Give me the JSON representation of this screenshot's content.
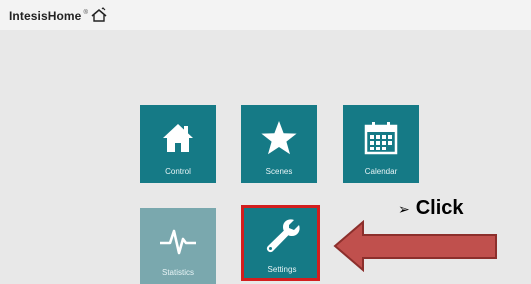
{
  "app": {
    "logo_text": "IntesisHome",
    "logo_mark": "®"
  },
  "tiles": {
    "control": {
      "label": "Control",
      "icon": "home-icon"
    },
    "scenes": {
      "label": "Scenes",
      "icon": "star-icon"
    },
    "calendar": {
      "label": "Calendar",
      "icon": "calendar-icon"
    },
    "statistics": {
      "label": "Statistics",
      "icon": "pulse-icon"
    },
    "settings": {
      "label": "Settings",
      "icon": "wrench-icon"
    }
  },
  "annotation": {
    "bullet": "➢",
    "text": "Click"
  },
  "colors": {
    "tile": "#157a86",
    "tile_disabled": "#7aa8ae",
    "highlight": "#d21e1e",
    "arrow_fill": "#c0504d",
    "arrow_border": "#8c2f2c"
  }
}
